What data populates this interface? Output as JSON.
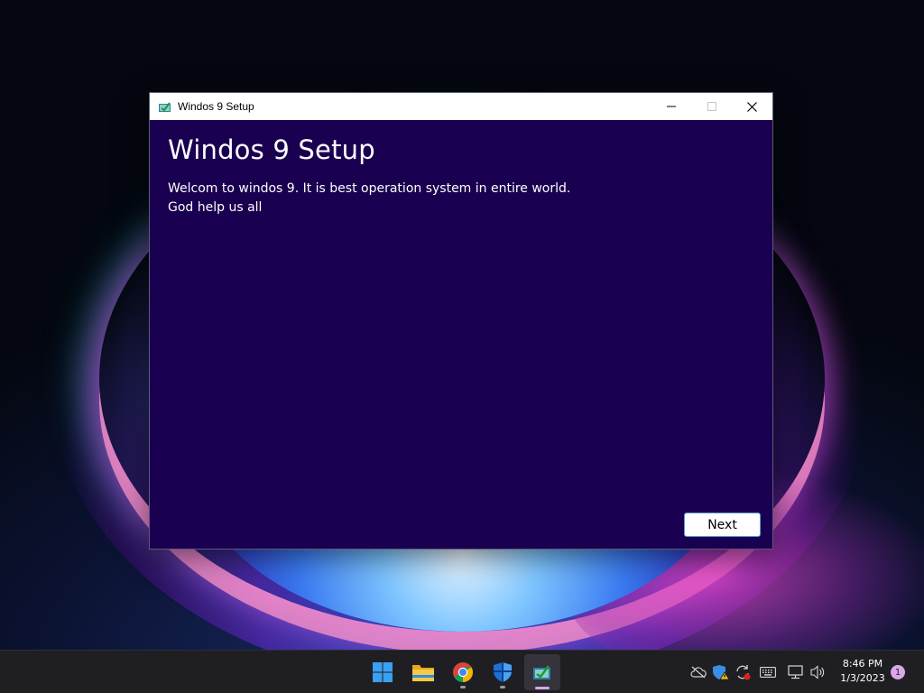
{
  "window": {
    "title": "Windos 9 Setup",
    "heading": "Windos 9 Setup",
    "body_lines": [
      "Welcom to windos 9. It is best operation system in entire world.",
      "God help us all"
    ],
    "next_label": "Next",
    "background_color": "#1a0050"
  },
  "taskbar": {
    "apps": [
      {
        "name": "Start",
        "icon": "windows-logo-icon",
        "state": "normal"
      },
      {
        "name": "File Explorer",
        "icon": "folder-icon",
        "state": "normal"
      },
      {
        "name": "Google Chrome",
        "icon": "chrome-icon",
        "state": "running"
      },
      {
        "name": "Windows Security",
        "icon": "shield-icon",
        "state": "running"
      },
      {
        "name": "Windos 9 Setup",
        "icon": "setup-app-icon",
        "state": "active"
      }
    ],
    "tray": {
      "time": "8:46 PM",
      "date": "1/3/2023",
      "notification_count": "1",
      "icons": [
        "cloud-offline-icon",
        "defender-warning-icon",
        "sync-error-icon",
        "keyboard-icon",
        "network-icon",
        "volume-icon"
      ]
    }
  }
}
